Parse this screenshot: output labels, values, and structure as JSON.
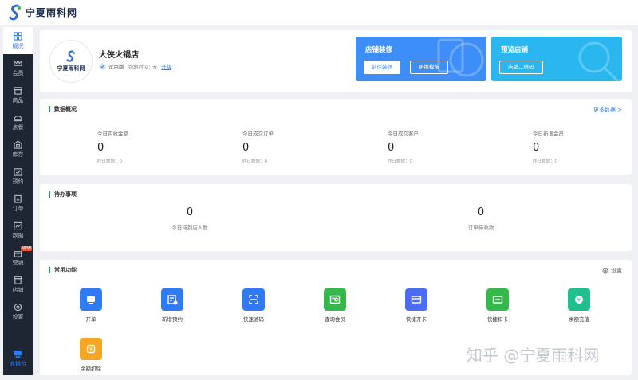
{
  "brand": {
    "logo_text": "宁夏雨科网"
  },
  "sidebar": {
    "items": [
      {
        "label": "概况",
        "icon": "overview-icon",
        "active": true
      },
      {
        "label": "会员",
        "icon": "crown-icon"
      },
      {
        "label": "商品",
        "icon": "box-icon"
      },
      {
        "label": "点餐",
        "icon": "dish-icon"
      },
      {
        "label": "库存",
        "icon": "warehouse-icon"
      },
      {
        "label": "预约",
        "icon": "calendar-check-icon"
      },
      {
        "label": "订单",
        "icon": "clipboard-icon"
      },
      {
        "label": "数据",
        "icon": "chart-icon"
      },
      {
        "label": "营销",
        "icon": "gift-icon",
        "badge": "NEW"
      },
      {
        "label": "店铺",
        "icon": "store-icon"
      },
      {
        "label": "设置",
        "icon": "gear-icon"
      }
    ],
    "cashier_label": "收银台"
  },
  "store": {
    "name": "大侠火锅店",
    "avatar_text": "宁夏雨科网",
    "version": "试用版",
    "expire_label": "到期时间: 无",
    "upgrade_label": "升级"
  },
  "promo_decorate": {
    "title": "店铺装修",
    "btn_primary": "前往装修",
    "btn_secondary": "更换模板",
    "color": "#3d8ef8"
  },
  "promo_preview": {
    "title": "预览店铺",
    "btn": "店铺二维码",
    "color": "#2ab7f0"
  },
  "overview": {
    "title": "数据概况",
    "more_label": "更多数据 >",
    "stats": [
      {
        "label": "今日实收金额",
        "value": "0",
        "sub": "昨日数据：0"
      },
      {
        "label": "今日成交订单",
        "value": "0",
        "sub": "昨日数据：0"
      },
      {
        "label": "今日成交客户",
        "value": "0",
        "sub": "昨日数据：0"
      },
      {
        "label": "今日新增会员",
        "value": "0",
        "sub": "昨日数据：0"
      }
    ]
  },
  "todo": {
    "title": "待办事项",
    "items": [
      {
        "value": "0",
        "label": "今日待到店人数"
      },
      {
        "value": "0",
        "label": "订单待收款"
      }
    ]
  },
  "functions": {
    "title": "常用功能",
    "settings_label": "设置",
    "items": [
      {
        "label": "开单",
        "color": "#2f7bf5",
        "icon": "open-order-icon"
      },
      {
        "label": "新增预约",
        "color": "#2f7bf5",
        "icon": "add-booking-icon"
      },
      {
        "label": "快速验码",
        "color": "#2f7bf5",
        "icon": "scan-code-icon"
      },
      {
        "label": "查询会员",
        "color": "#35b84a",
        "icon": "member-search-icon"
      },
      {
        "label": "快捷开卡",
        "color": "#4b6cf0",
        "icon": "card-open-icon"
      },
      {
        "label": "快捷扣卡",
        "color": "#35b84a",
        "icon": "card-deduct-icon"
      },
      {
        "label": "余额充值",
        "color": "#1fbf8f",
        "icon": "balance-recharge-icon"
      },
      {
        "label": "余额扣除",
        "color": "#f5a623",
        "icon": "balance-deduct-icon"
      }
    ]
  },
  "watermark": "知乎 @宁夏雨科网"
}
